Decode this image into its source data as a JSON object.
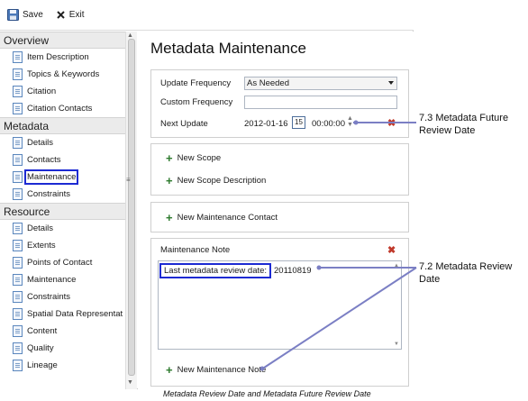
{
  "toolbar": {
    "save_label": "Save",
    "exit_label": "Exit"
  },
  "sidebar": {
    "sections": [
      {
        "title": "Overview",
        "items": [
          "Item Description",
          "Topics & Keywords",
          "Citation",
          "Citation Contacts"
        ]
      },
      {
        "title": "Metadata",
        "items": [
          "Details",
          "Contacts",
          "Maintenance",
          "Constraints"
        ]
      },
      {
        "title": "Resource",
        "items": [
          "Details",
          "Extents",
          "Points of Contact",
          "Maintenance",
          "Constraints",
          "Spatial Data Representat",
          "Content",
          "Quality",
          "Lineage"
        ]
      }
    ],
    "selected": "Maintenance"
  },
  "main": {
    "title": "Metadata Maintenance",
    "update_frequency_label": "Update Frequency",
    "update_frequency_value": "As Needed",
    "custom_frequency_label": "Custom Frequency",
    "custom_frequency_value": "",
    "next_update_label": "Next Update",
    "next_update_date": "2012-01-16",
    "calendar_day": "15",
    "next_update_time": "00:00:00",
    "new_scope": "New Scope",
    "new_scope_description": "New Scope Description",
    "new_maintenance_contact": "New Maintenance Contact",
    "maintenance_note_label": "Maintenance Note",
    "maintenance_note_prefix": "Last metadata review date:",
    "maintenance_note_value": " 20110819",
    "new_maintenance_note": "New Maintenance Note"
  },
  "callouts": {
    "future_review_line1": "7.3 Metadata Future",
    "future_review_line2": "Review Date",
    "review_line1": "7.2 Metadata Review",
    "review_line2": "Date"
  },
  "caption": "Metadata Review Date and Metadata Future Review Date",
  "colors": {
    "highlight_box": "#1c2ad3",
    "callout_line": "#7b7fc4",
    "add_icon": "#2d7a2d",
    "delete_icon": "#c0392b"
  },
  "icons": [
    "save-icon",
    "close-icon",
    "document-icon",
    "calendar-icon",
    "spinner-icon",
    "plus-icon",
    "delete-icon"
  ]
}
